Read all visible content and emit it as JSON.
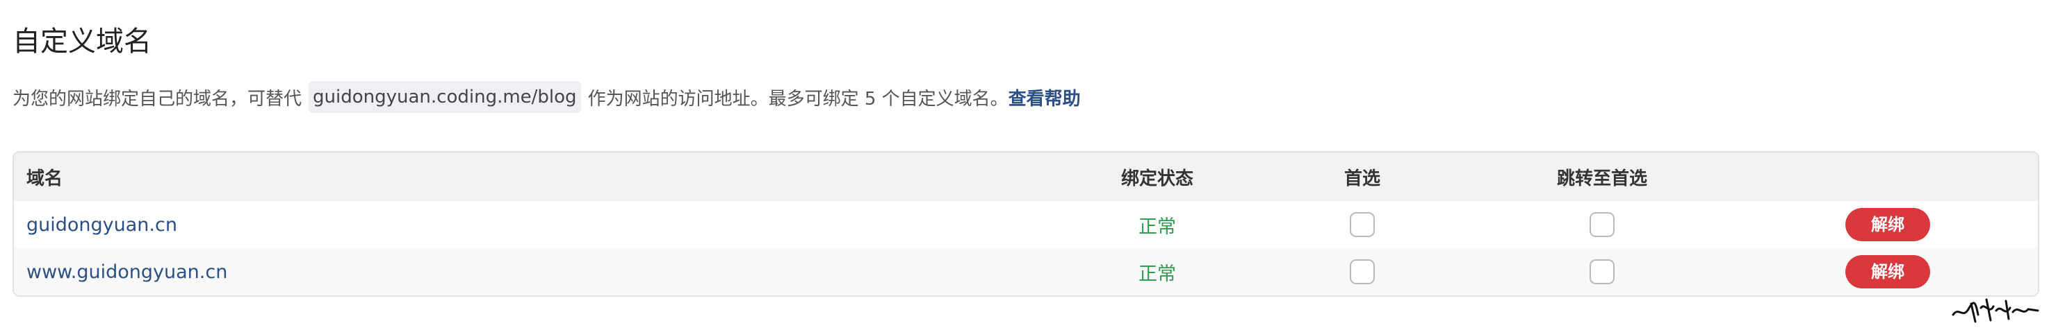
{
  "page": {
    "title": "自定义域名"
  },
  "description": {
    "before": "为您的网站绑定自己的域名，可替代",
    "default_domain": "guidongyuan.coding.me/blog",
    "after": "作为网站的访问地址。最多可绑定 5 个自定义域名。",
    "help_link": "查看帮助"
  },
  "table": {
    "headers": {
      "domain": "域名",
      "status": "绑定状态",
      "preferred": "首选",
      "redirect": "跳转至首选"
    },
    "rows": [
      {
        "domain": "guidongyuan.cn",
        "status": "正常",
        "preferred_checked": false,
        "redirect_checked": false,
        "action": "解绑"
      },
      {
        "domain": "www.guidongyuan.cn",
        "status": "正常",
        "preferred_checked": false,
        "redirect_checked": false,
        "action": "解绑"
      }
    ]
  },
  "colors": {
    "link": "#2c4f86",
    "status_ok": "#2e9d4d",
    "danger": "#d9393e",
    "header_bg": "#f2f2f2",
    "code_bg": "#eef0f3"
  },
  "icons": {
    "watermark": "signature-watermark"
  }
}
